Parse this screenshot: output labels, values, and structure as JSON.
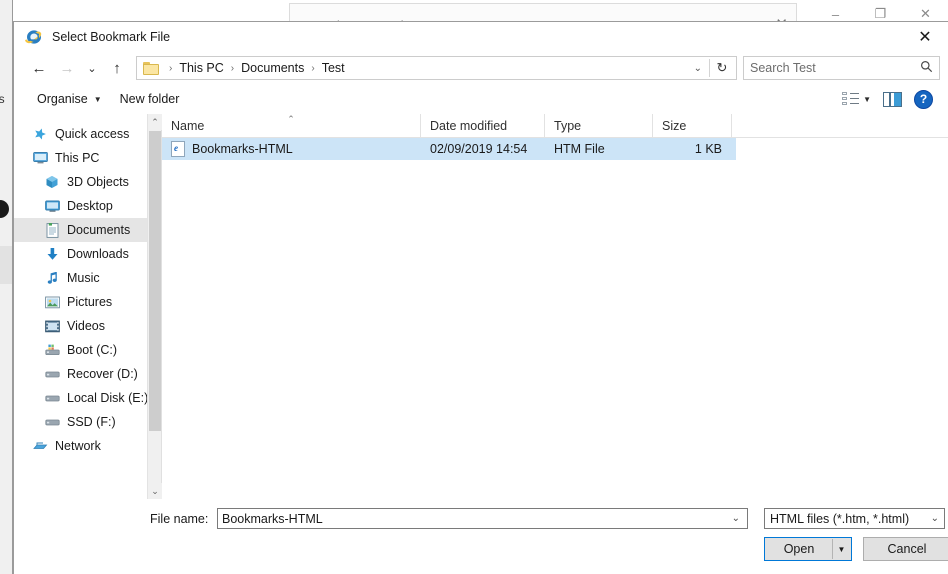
{
  "background_window": {
    "subwindow_title": "Import/Export Settings",
    "subwindow_close": "✕",
    "left_strip_text": "us",
    "window_buttons": {
      "minimize": "–",
      "restore": "❐",
      "close": "✕"
    }
  },
  "dialog": {
    "title": "Select Bookmark File",
    "title_icon": "internet-explorer-icon",
    "close_label": "✕",
    "nav": {
      "back": "←",
      "forward": "→",
      "recent": "⌄",
      "up": "↑",
      "breadcrumb": [
        "This PC",
        "Documents",
        "Test"
      ],
      "breadcrumb_separator": "›",
      "breadcrumb_caret": "⌄",
      "refresh": "↻",
      "search_placeholder": "Search Test",
      "search_icon": "🔍"
    },
    "toolbar": {
      "organise_label": "Organise",
      "organise_caret": "▼",
      "new_folder_label": "New folder",
      "view_caret": "▼",
      "help_label": "?"
    },
    "sidebar": {
      "items": [
        {
          "label": "Quick access",
          "icon": "star-icon",
          "indent": false,
          "selected": false
        },
        {
          "label": "This PC",
          "icon": "monitor-icon",
          "indent": false,
          "selected": false
        },
        {
          "label": "3D Objects",
          "icon": "cube-icon",
          "indent": true,
          "selected": false
        },
        {
          "label": "Desktop",
          "icon": "desktop-icon",
          "indent": true,
          "selected": false
        },
        {
          "label": "Documents",
          "icon": "documents-icon",
          "indent": true,
          "selected": true
        },
        {
          "label": "Downloads",
          "icon": "download-icon",
          "indent": true,
          "selected": false
        },
        {
          "label": "Music",
          "icon": "music-note-icon",
          "indent": true,
          "selected": false
        },
        {
          "label": "Pictures",
          "icon": "picture-icon",
          "indent": true,
          "selected": false
        },
        {
          "label": "Videos",
          "icon": "video-icon",
          "indent": true,
          "selected": false
        },
        {
          "label": "Boot (C:)",
          "icon": "system-drive-icon",
          "indent": true,
          "selected": false
        },
        {
          "label": "Recover (D:)",
          "icon": "drive-icon",
          "indent": true,
          "selected": false
        },
        {
          "label": "Local Disk (E:)",
          "icon": "drive-icon",
          "indent": true,
          "selected": false
        },
        {
          "label": "SSD (F:)",
          "icon": "drive-icon",
          "indent": true,
          "selected": false
        },
        {
          "label": "Network",
          "icon": "network-icon",
          "indent": false,
          "selected": false
        }
      ],
      "scroll_up": "⌃",
      "scroll_down": "⌄"
    },
    "filelist": {
      "columns": [
        "Name",
        "Date modified",
        "Type",
        "Size"
      ],
      "sort_indicator": "⌃",
      "rows": [
        {
          "name": "Bookmarks-HTML",
          "icon": "htm-file-icon",
          "icon_letter": "e",
          "date_modified": "02/09/2019 14:54",
          "type": "HTM File",
          "size": "1 KB",
          "selected": true
        }
      ]
    },
    "footer": {
      "filename_label": "File name:",
      "filename_value": "Bookmarks-HTML",
      "filename_caret": "⌄",
      "filter_value": "HTML files (*.htm, *.html)",
      "filter_caret": "⌄",
      "open_label": "Open",
      "open_caret": "▼",
      "cancel_label": "Cancel"
    }
  },
  "colors": {
    "selection_blue": "#cce4f7",
    "focus_blue": "#0078d7",
    "accent_blue": "#1565c0"
  }
}
